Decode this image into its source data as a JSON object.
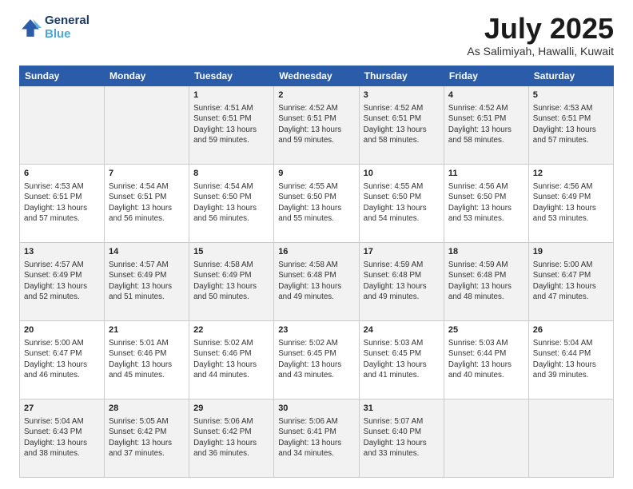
{
  "header": {
    "logo_line1": "General",
    "logo_line2": "Blue",
    "month": "July 2025",
    "location": "As Salimiyah, Hawalli, Kuwait"
  },
  "days_of_week": [
    "Sunday",
    "Monday",
    "Tuesday",
    "Wednesday",
    "Thursday",
    "Friday",
    "Saturday"
  ],
  "weeks": [
    [
      {
        "day": "",
        "info": ""
      },
      {
        "day": "",
        "info": ""
      },
      {
        "day": "1",
        "info": "Sunrise: 4:51 AM\nSunset: 6:51 PM\nDaylight: 13 hours\nand 59 minutes."
      },
      {
        "day": "2",
        "info": "Sunrise: 4:52 AM\nSunset: 6:51 PM\nDaylight: 13 hours\nand 59 minutes."
      },
      {
        "day": "3",
        "info": "Sunrise: 4:52 AM\nSunset: 6:51 PM\nDaylight: 13 hours\nand 58 minutes."
      },
      {
        "day": "4",
        "info": "Sunrise: 4:52 AM\nSunset: 6:51 PM\nDaylight: 13 hours\nand 58 minutes."
      },
      {
        "day": "5",
        "info": "Sunrise: 4:53 AM\nSunset: 6:51 PM\nDaylight: 13 hours\nand 57 minutes."
      }
    ],
    [
      {
        "day": "6",
        "info": "Sunrise: 4:53 AM\nSunset: 6:51 PM\nDaylight: 13 hours\nand 57 minutes."
      },
      {
        "day": "7",
        "info": "Sunrise: 4:54 AM\nSunset: 6:51 PM\nDaylight: 13 hours\nand 56 minutes."
      },
      {
        "day": "8",
        "info": "Sunrise: 4:54 AM\nSunset: 6:50 PM\nDaylight: 13 hours\nand 56 minutes."
      },
      {
        "day": "9",
        "info": "Sunrise: 4:55 AM\nSunset: 6:50 PM\nDaylight: 13 hours\nand 55 minutes."
      },
      {
        "day": "10",
        "info": "Sunrise: 4:55 AM\nSunset: 6:50 PM\nDaylight: 13 hours\nand 54 minutes."
      },
      {
        "day": "11",
        "info": "Sunrise: 4:56 AM\nSunset: 6:50 PM\nDaylight: 13 hours\nand 53 minutes."
      },
      {
        "day": "12",
        "info": "Sunrise: 4:56 AM\nSunset: 6:49 PM\nDaylight: 13 hours\nand 53 minutes."
      }
    ],
    [
      {
        "day": "13",
        "info": "Sunrise: 4:57 AM\nSunset: 6:49 PM\nDaylight: 13 hours\nand 52 minutes."
      },
      {
        "day": "14",
        "info": "Sunrise: 4:57 AM\nSunset: 6:49 PM\nDaylight: 13 hours\nand 51 minutes."
      },
      {
        "day": "15",
        "info": "Sunrise: 4:58 AM\nSunset: 6:49 PM\nDaylight: 13 hours\nand 50 minutes."
      },
      {
        "day": "16",
        "info": "Sunrise: 4:58 AM\nSunset: 6:48 PM\nDaylight: 13 hours\nand 49 minutes."
      },
      {
        "day": "17",
        "info": "Sunrise: 4:59 AM\nSunset: 6:48 PM\nDaylight: 13 hours\nand 49 minutes."
      },
      {
        "day": "18",
        "info": "Sunrise: 4:59 AM\nSunset: 6:48 PM\nDaylight: 13 hours\nand 48 minutes."
      },
      {
        "day": "19",
        "info": "Sunrise: 5:00 AM\nSunset: 6:47 PM\nDaylight: 13 hours\nand 47 minutes."
      }
    ],
    [
      {
        "day": "20",
        "info": "Sunrise: 5:00 AM\nSunset: 6:47 PM\nDaylight: 13 hours\nand 46 minutes."
      },
      {
        "day": "21",
        "info": "Sunrise: 5:01 AM\nSunset: 6:46 PM\nDaylight: 13 hours\nand 45 minutes."
      },
      {
        "day": "22",
        "info": "Sunrise: 5:02 AM\nSunset: 6:46 PM\nDaylight: 13 hours\nand 44 minutes."
      },
      {
        "day": "23",
        "info": "Sunrise: 5:02 AM\nSunset: 6:45 PM\nDaylight: 13 hours\nand 43 minutes."
      },
      {
        "day": "24",
        "info": "Sunrise: 5:03 AM\nSunset: 6:45 PM\nDaylight: 13 hours\nand 41 minutes."
      },
      {
        "day": "25",
        "info": "Sunrise: 5:03 AM\nSunset: 6:44 PM\nDaylight: 13 hours\nand 40 minutes."
      },
      {
        "day": "26",
        "info": "Sunrise: 5:04 AM\nSunset: 6:44 PM\nDaylight: 13 hours\nand 39 minutes."
      }
    ],
    [
      {
        "day": "27",
        "info": "Sunrise: 5:04 AM\nSunset: 6:43 PM\nDaylight: 13 hours\nand 38 minutes."
      },
      {
        "day": "28",
        "info": "Sunrise: 5:05 AM\nSunset: 6:42 PM\nDaylight: 13 hours\nand 37 minutes."
      },
      {
        "day": "29",
        "info": "Sunrise: 5:06 AM\nSunset: 6:42 PM\nDaylight: 13 hours\nand 36 minutes."
      },
      {
        "day": "30",
        "info": "Sunrise: 5:06 AM\nSunset: 6:41 PM\nDaylight: 13 hours\nand 34 minutes."
      },
      {
        "day": "31",
        "info": "Sunrise: 5:07 AM\nSunset: 6:40 PM\nDaylight: 13 hours\nand 33 minutes."
      },
      {
        "day": "",
        "info": ""
      },
      {
        "day": "",
        "info": ""
      }
    ]
  ]
}
